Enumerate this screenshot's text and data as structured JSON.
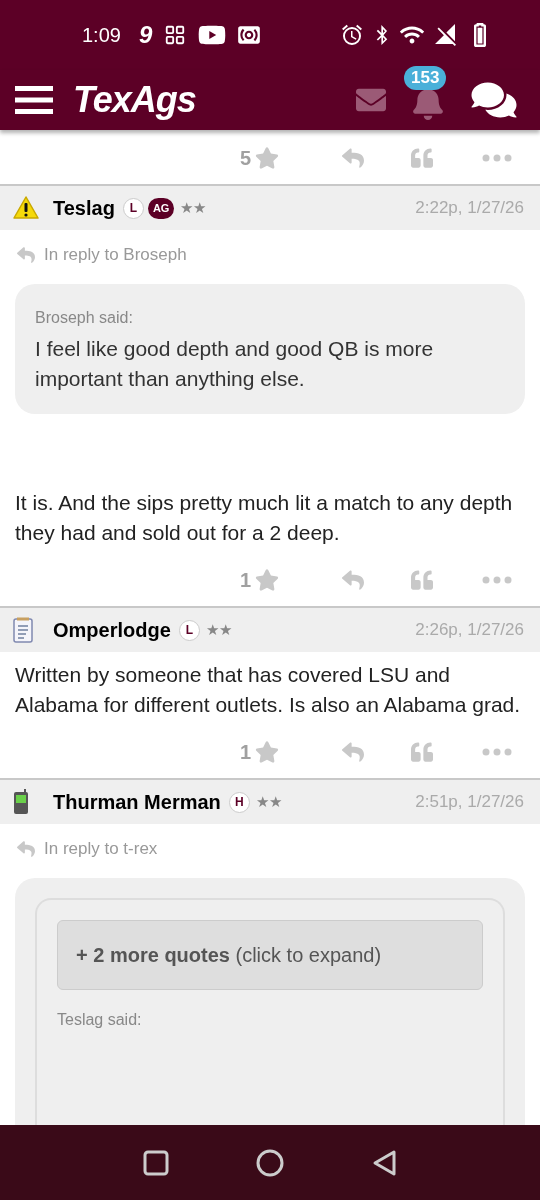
{
  "status_bar": {
    "time": "1:09",
    "app_glyph": "9"
  },
  "header": {
    "logo": "TexAgs",
    "notification_count": "153"
  },
  "top_actions": {
    "rating": "5"
  },
  "posts": [
    {
      "author": "Teslag",
      "avatar": {
        "kind": "warning"
      },
      "badges": [
        {
          "label": "L",
          "kind": "outline"
        },
        {
          "label": "AG",
          "kind": "filled"
        }
      ],
      "rank": "★★",
      "time": "2:22p, 1/27/26",
      "reply_to": "In reply to Broseph",
      "quote": {
        "author": "Broseph said:",
        "text": "I feel like good depth and good QB is more important than anything else."
      },
      "body": "It is. And the sips pretty much lit a match to any depth they had and sold out for a 2 deep.",
      "rating": "1"
    },
    {
      "author": "Omperlodge",
      "avatar": {
        "kind": "notepad"
      },
      "badges": [
        {
          "label": "L",
          "kind": "outline"
        }
      ],
      "rank": "★★",
      "time": "2:26p, 1/27/26",
      "body": "Written by someone that has covered LSU and Alabama for different outlets. Is also an Alabama grad.",
      "rating": "1"
    },
    {
      "author": "Thurman Merman",
      "avatar": {
        "kind": "phone"
      },
      "badges": [
        {
          "label": "H",
          "kind": "outline"
        }
      ],
      "rank": "★★",
      "time": "2:51p, 1/27/26",
      "reply_to": "In reply to t-rex",
      "nested_quote": {
        "expander": "**+ 2 more quotes** (click to expand)",
        "author": "Teslag said:"
      }
    }
  ]
}
